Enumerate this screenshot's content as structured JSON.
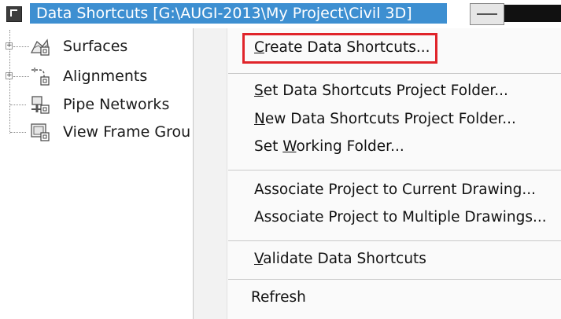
{
  "title_bar": {
    "label": "Data Shortcuts [G:\\AUGI-2013\\My Project\\Civil 3D]",
    "highlight_color": "#3d8fd1",
    "icon": "data-shortcuts-icon"
  },
  "tree": {
    "items": [
      {
        "label": "Surfaces",
        "icon": "surface-icon",
        "expandable": true
      },
      {
        "label": "Alignments",
        "icon": "alignment-icon",
        "expandable": true
      },
      {
        "label": "Pipe Networks",
        "icon": "pipe-network-icon",
        "expandable": false
      },
      {
        "label": "View Frame Grou",
        "icon": "view-frame-group-icon",
        "expandable": false
      }
    ]
  },
  "context_menu": {
    "highlight_color": "#e0242a",
    "items": {
      "create_data_shortcuts": {
        "pre": "",
        "accel": "C",
        "post": "reate Data Shortcuts..."
      },
      "set_project_folder": {
        "pre": "",
        "accel": "S",
        "post": "et Data Shortcuts Project Folder..."
      },
      "new_project_folder": {
        "pre": "",
        "accel": "N",
        "post": "ew Data Shortcuts Project Folder..."
      },
      "set_working_folder": {
        "pre": "Set ",
        "accel": "W",
        "post": "orking Folder..."
      },
      "associate_current": {
        "text": "Associate Project to Current Drawing..."
      },
      "associate_multiple": {
        "text": "Associate Project to Multiple Drawings..."
      },
      "validate": {
        "pre": "",
        "accel": "V",
        "post": "alidate Data Shortcuts"
      },
      "refresh": {
        "text": "Refresh"
      }
    }
  }
}
